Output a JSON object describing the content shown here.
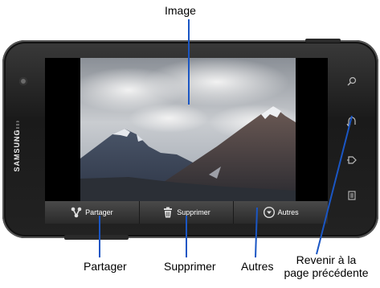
{
  "callouts": {
    "image": "Image",
    "partager": "Partager",
    "supprimer": "Supprimer",
    "autres": "Autres",
    "revenir_line1": "Revenir à la",
    "revenir_line2": "page précédente"
  },
  "device": {
    "brand": "SAMSUNG"
  },
  "action_bar": {
    "share_label": "Partager",
    "delete_label": "Supprimer",
    "more_label": "Autres"
  },
  "icons": {
    "share": "share-icon",
    "delete": "trash-icon",
    "more": "chevron-down-circle-icon",
    "search": "search-icon",
    "back": "back-icon",
    "home": "home-icon",
    "menu": "menu-icon"
  },
  "colors": {
    "leader_line": "#1a56c4",
    "device_body": "#2a2a2a"
  }
}
